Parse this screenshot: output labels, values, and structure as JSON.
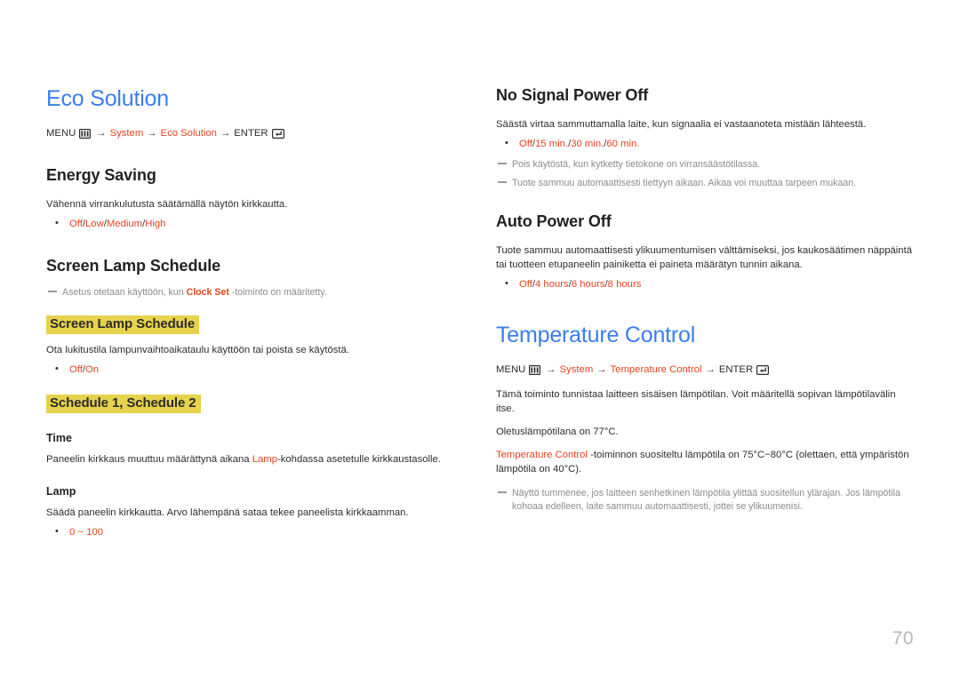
{
  "page_number": "70",
  "colors": {
    "chapter_blue": "#3a7ef0",
    "accent_orange": "#e8431f",
    "highlight_yellow": "#e7d24d",
    "note_gray": "#8c8c8c",
    "page_number_gray": "#b9b9b9"
  },
  "left_column": {
    "chapter_title": "Eco Solution",
    "path": {
      "menu_label": "MENU",
      "menu_icon": "menu-grid-icon",
      "arrow": "→",
      "step1": "System",
      "step2": "Eco Solution",
      "enter_label": "ENTER",
      "enter_icon": "enter-return-icon"
    },
    "energy_saving": {
      "heading": "Energy Saving",
      "description": "Vähennä virrankulutusta säätämällä näytön kirkkautta.",
      "options": [
        "Off",
        "Low",
        "Medium",
        "High"
      ],
      "separator": "/"
    },
    "screen_lamp_schedule": {
      "heading": "Screen Lamp Schedule",
      "note": {
        "prefix": "Asetus otetaan käyttöön, kun ",
        "bold": "Clock Set",
        "suffix": " -toiminto on määritetty."
      },
      "highlight1": "Screen Lamp Schedule",
      "description": "Ota lukitustila lampunvaihtoaikataulu käyttöön tai poista se käytöstä.",
      "options": [
        "Off",
        "On"
      ],
      "separator": "/",
      "highlight2": "Schedule 1, Schedule 2",
      "time": {
        "heading": "Time",
        "desc_prefix": "Paneelin kirkkaus muuttuu määrättynä aikana ",
        "desc_accent": "Lamp",
        "desc_suffix": "-kohdassa asetetulle kirkkaustasolle."
      },
      "lamp": {
        "heading": "Lamp",
        "description": "Säädä paneelin kirkkautta. Arvo lähempänä sataa tekee paneelista kirkkaamman.",
        "range": "0 ~ 100"
      }
    }
  },
  "right_column": {
    "no_signal_power_off": {
      "heading": "No Signal Power Off",
      "description": "Säästä virtaa sammuttamalla laite, kun signaalia ei vastaanoteta mistään lähteestä.",
      "options": [
        "Off",
        "15 min.",
        "30 min.",
        "60 min."
      ],
      "separator": "/",
      "note1": "Pois käytöstä, kun kytketty tietokone on virransäästötilassa.",
      "note2": "Tuote sammuu automaattisesti tiettyyn aikaan. Aikaa voi muuttaa tarpeen mukaan."
    },
    "auto_power_off": {
      "heading": "Auto Power Off",
      "description": "Tuote sammuu automaattisesti ylikuumentumisen välttämiseksi, jos kaukosäätimen näppäintä tai tuotteen etupaneelin painiketta ei paineta määrätyn tunnin aikana.",
      "options": [
        "Off",
        "4 hours",
        "6 hours",
        "8 hours"
      ],
      "separator": "/"
    },
    "temperature_control": {
      "chapter_title": "Temperature Control",
      "path": {
        "menu_label": "MENU",
        "menu_icon": "menu-grid-icon",
        "arrow": "→",
        "step1": "System",
        "step2": "Temperature Control",
        "enter_label": "ENTER",
        "enter_icon": "enter-return-icon"
      },
      "para1": "Tämä toiminto tunnistaa laitteen sisäisen lämpötilan. Voit määritellä sopivan lämpötilavälin itse.",
      "para2": "Oletuslämpötilana on 77°C.",
      "para3_accent": "Temperature Control",
      "para3_rest": " -toiminnon suositeltu lämpötila on 75°C−80°C (olettaen, että ympäristön lämpötila on 40°C).",
      "note1": "Näyttö tummenee, jos laitteen senhetkinen lämpötila ylittää suositellun ylärajan. Jos lämpötila kohoaa edelleen, laite sammuu automaattisesti, jottei se ylikuumenisi."
    }
  }
}
